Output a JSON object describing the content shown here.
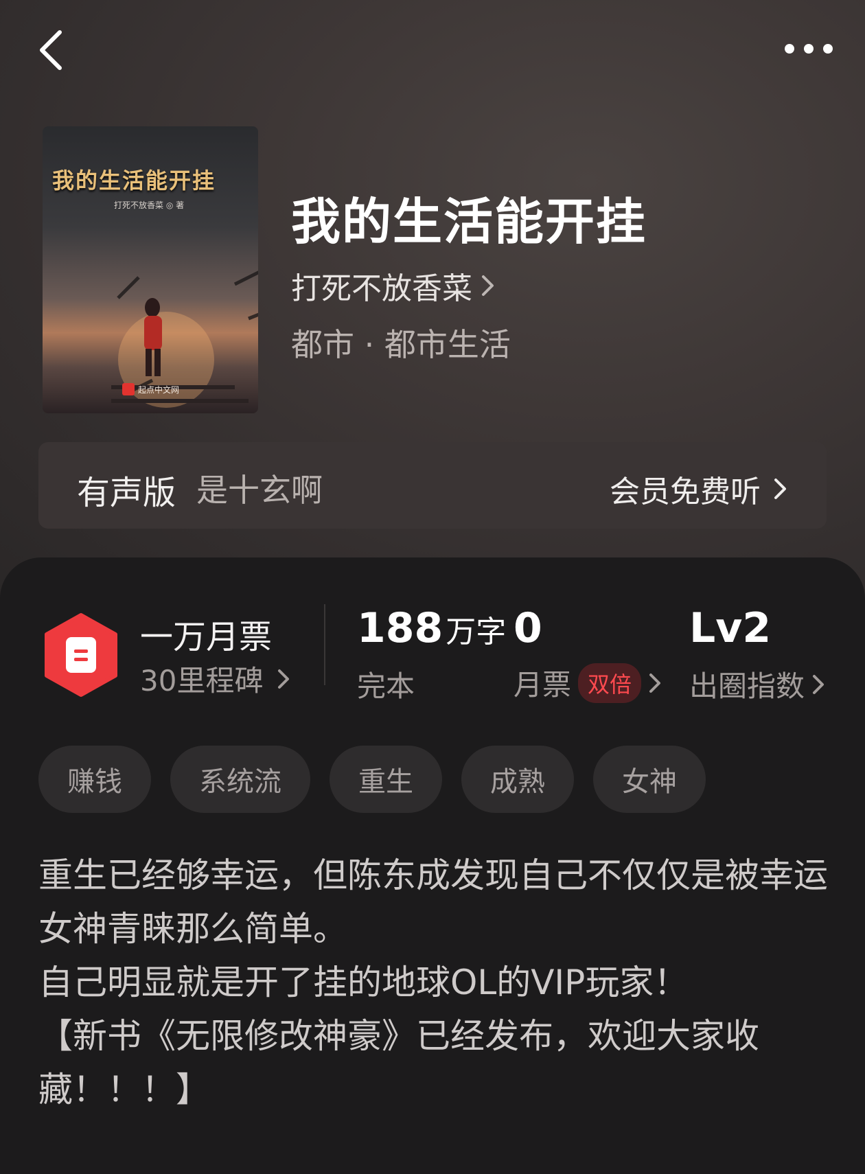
{
  "book": {
    "title": "我的生活能开挂",
    "author": "打死不放香菜",
    "genre": "都市 · 都市生活",
    "cover": {
      "title": "我的生活能开挂",
      "author_line": "打死不放香菜 ◎ 著",
      "publisher": "起点中文网"
    }
  },
  "audio": {
    "label": "有声版",
    "narrator": "是十玄啊",
    "action": "会员免费听"
  },
  "stats": {
    "monthly_title": "一万月票",
    "milestone": "30里程碑",
    "wordcount_num": "188",
    "wordcount_unit": "万字",
    "status": "完本",
    "votes_num": "0",
    "votes_label": "月票",
    "double_badge": "双倍",
    "level_num": "Lv2",
    "level_label": "出圈指数"
  },
  "tags": [
    "赚钱",
    "系统流",
    "重生",
    "成熟",
    "女神"
  ],
  "synopsis": [
    "重生已经够幸运，但陈东成发现自己不仅仅是被幸运女神青睐那么简单。",
    "自己明显就是开了挂的地球OL的VIP玩家！",
    "【新书《无限修改神豪》已经发布，欢迎大家收藏！！！】"
  ],
  "colors": {
    "accent_red": "#e2332f",
    "badge_red": "#ff4a4f",
    "sheet_bg": "#1c1b1c",
    "hero_bg": "#3f3837"
  }
}
